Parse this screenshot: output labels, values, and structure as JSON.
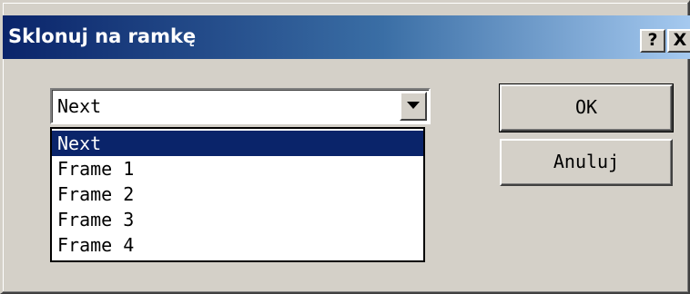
{
  "window": {
    "title": "Sklonuj na ramkę",
    "help_label": "?",
    "close_label": "X"
  },
  "combo": {
    "selected": "Next",
    "options": [
      "Next",
      "Frame 1",
      "Frame 2",
      "Frame 3",
      "Frame 4"
    ],
    "highlighted_index": 0
  },
  "buttons": {
    "ok": "OK",
    "cancel": "Anuluj"
  },
  "colors": {
    "titlebar_start": "#0a246a",
    "titlebar_end": "#a6caf0",
    "selection": "#0a246a",
    "face": "#d4d0c8"
  }
}
